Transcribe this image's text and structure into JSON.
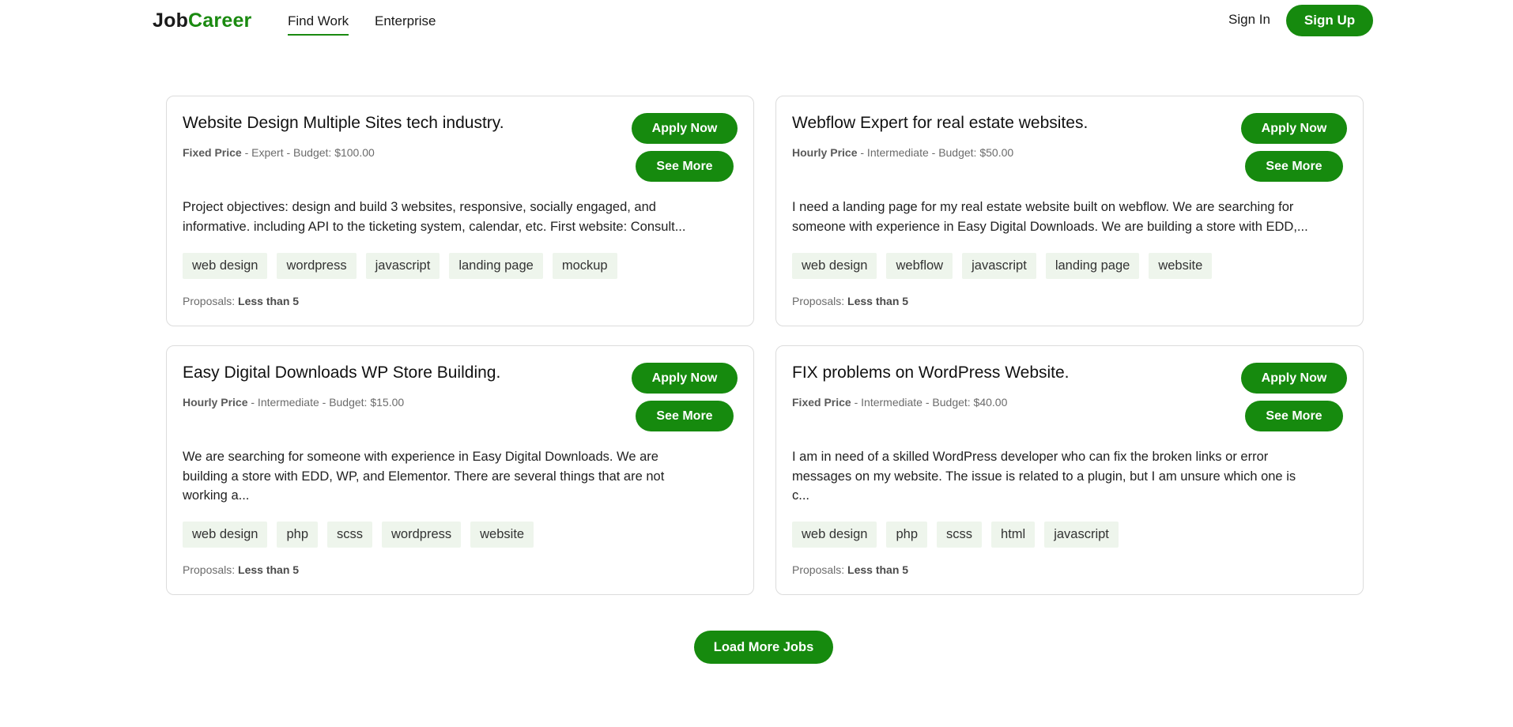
{
  "header": {
    "logo_part1": "Job",
    "logo_part2": "Career",
    "nav": [
      {
        "label": "Find Work",
        "active": true
      },
      {
        "label": "Enterprise",
        "active": false
      }
    ],
    "signin_label": "Sign In",
    "signup_label": "Sign Up"
  },
  "common": {
    "apply_label": "Apply Now",
    "see_more_label": "See More",
    "proposals_label": "Proposals:"
  },
  "jobs": [
    {
      "title": "Website Design Multiple Sites tech industry.",
      "price_type": "Fixed Price",
      "level_budget": " - Expert - Budget: $100.00",
      "description_lines": [
        "Project objectives: design and build 3 websites, responsive, socially engaged, and",
        "informative. including API to the ticketing system, calendar, etc. First website: Consult..."
      ],
      "tags": [
        "web design",
        "wordpress",
        "javascript",
        "landing page",
        "mockup"
      ],
      "proposals": "Less than 5"
    },
    {
      "title": "Webflow Expert for real estate websites.",
      "price_type": "Hourly Price",
      "level_budget": " - Intermediate - Budget: $50.00",
      "description_lines": [
        "I need a landing page for my real estate website built on webflow. We are searching for",
        "someone with experience in Easy Digital Downloads. We are building a store with EDD,..."
      ],
      "tags": [
        "web design",
        "webflow",
        "javascript",
        "landing page",
        "website"
      ],
      "proposals": "Less than 5"
    },
    {
      "title": "Easy Digital Downloads WP Store Building.",
      "price_type": "Hourly Price",
      "level_budget": " - Intermediate - Budget: $15.00",
      "description_lines": [
        "We are searching for someone with experience in Easy Digital Downloads. We are",
        "building a store with EDD, WP, and Elementor. There are several things that are not",
        "working a..."
      ],
      "tags": [
        "web design",
        "php",
        "scss",
        "wordpress",
        "website"
      ],
      "proposals": "Less than 5"
    },
    {
      "title": "FIX problems on WordPress Website.",
      "price_type": "Fixed Price",
      "level_budget": " - Intermediate - Budget: $40.00",
      "description_lines": [
        "I am in need of a skilled WordPress developer who can fix the broken links or error",
        "messages on my website. The issue is related to a plugin, but I am unsure which one is",
        "c..."
      ],
      "tags": [
        "web design",
        "php",
        "scss",
        "html",
        "javascript"
      ],
      "proposals": "Less than 5"
    }
  ],
  "load_more_label": "Load More Jobs",
  "colors": {
    "accent": "#168a0e",
    "tag_bg": "#eef5ec",
    "border": "#dcdcdc"
  }
}
